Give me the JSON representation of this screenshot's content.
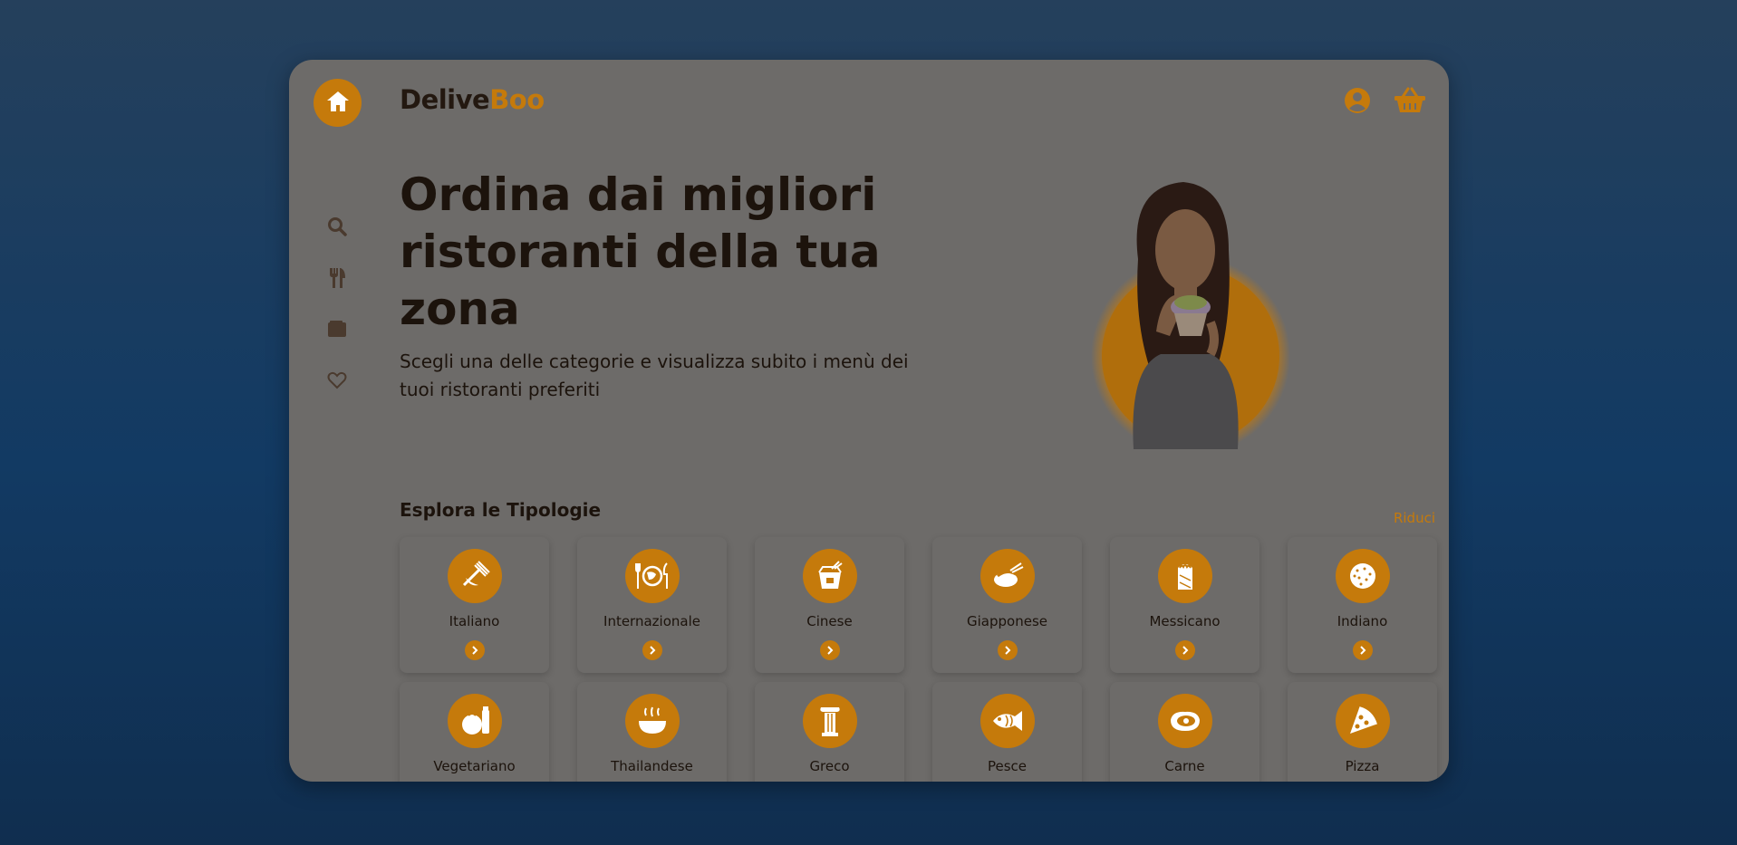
{
  "brand": {
    "name_part1": "Delive",
    "name_part2": "Boo",
    "accent_color": "#c57a0b"
  },
  "sidebar": {
    "items": [
      {
        "icon": "home-icon",
        "active": true
      },
      {
        "icon": "search-icon"
      },
      {
        "icon": "utensils-icon"
      },
      {
        "icon": "wallet-icon"
      },
      {
        "icon": "heart-icon"
      }
    ]
  },
  "header": {
    "icons": [
      "user-icon",
      "basket-icon"
    ]
  },
  "hero": {
    "title": "Ordina dai migliori ristoranti della tua zona",
    "subtitle": "Scegli una delle categorie e visualizza subito i menù dei tuoi ristoranti preferiti"
  },
  "categories": {
    "title": "Esplora le Tipologie",
    "toggle_label": "Riduci",
    "items": [
      {
        "label": "Italiano",
        "icon": "pasta-fork-icon"
      },
      {
        "label": "Internazionale",
        "icon": "globe-cutlery-icon"
      },
      {
        "label": "Cinese",
        "icon": "takeout-box-icon"
      },
      {
        "label": "Giapponese",
        "icon": "sushi-icon"
      },
      {
        "label": "Messicano",
        "icon": "burrito-icon"
      },
      {
        "label": "Indiano",
        "icon": "naan-icon"
      },
      {
        "label": "Vegetariano",
        "icon": "vegetables-icon"
      },
      {
        "label": "Thailandese",
        "icon": "soup-bowl-icon"
      },
      {
        "label": "Greco",
        "icon": "greek-column-icon"
      },
      {
        "label": "Pesce",
        "icon": "fish-icon"
      },
      {
        "label": "Carne",
        "icon": "steak-icon"
      },
      {
        "label": "Pizza",
        "icon": "pizza-slice-icon"
      }
    ]
  }
}
